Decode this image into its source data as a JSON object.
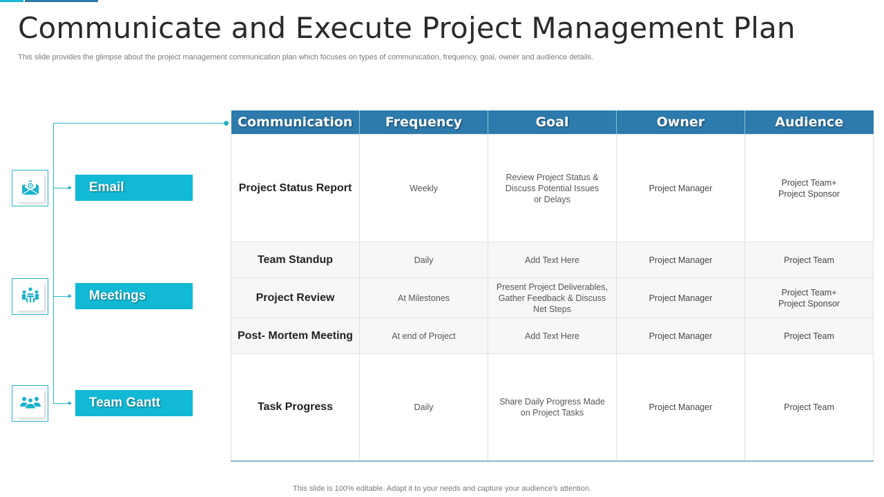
{
  "header": {
    "title": "Communicate and Execute Project Management Plan",
    "subtitle": "This slide provides the glimpse about the project management communication plan which focuses on types of communication, frequency, goal, owner and audience details."
  },
  "channels": [
    {
      "label": "Email",
      "icon": "email-envelope-icon"
    },
    {
      "label": "Meetings",
      "icon": "meeting-table-icon"
    },
    {
      "label": "Team Gantt",
      "icon": "team-group-icon"
    }
  ],
  "table": {
    "headers": [
      "Communication",
      "Frequency",
      "Goal",
      "Owner",
      "Audience"
    ],
    "rows": [
      {
        "communication": "Project Status Report",
        "frequency": "Weekly",
        "goal": [
          "Review  Project Status &",
          "Discuss Potential Issues",
          "or Delays"
        ],
        "owner": "Project Manager",
        "audience": [
          "Project Team+",
          "Project Sponsor"
        ]
      },
      {
        "communication": "Team Standup",
        "frequency": "Daily",
        "goal": [
          "Add Text Here"
        ],
        "owner": "Project Manager",
        "audience": [
          "Project Team"
        ]
      },
      {
        "communication": "Project Review",
        "frequency": "At Milestones",
        "goal": [
          "Present Project Deliverables,",
          "Gather Feedback & Discuss",
          "Net Steps"
        ],
        "owner": "Project Manager",
        "audience": [
          "Project Team+",
          "Project Sponsor"
        ]
      },
      {
        "communication": "Post- Mortem Meeting",
        "frequency": "At end of Project",
        "goal": [
          "Add Text Here"
        ],
        "owner": "Project Manager",
        "audience": [
          "Project Team"
        ]
      },
      {
        "communication": "Task Progress",
        "frequency": "Daily",
        "goal": [
          "Share Daily Progress Made",
          "on Project Tasks"
        ],
        "owner": "Project Manager",
        "audience": [
          "Project Team"
        ]
      }
    ]
  },
  "footer": "This slide is 100% editable. Adapt it to your needs and capture your audience's attention.",
  "colors": {
    "header_blue": "#2d7aac",
    "label_cyan": "#12b9d4",
    "connector_cyan": "#26b3cc",
    "accent_cyan": "#1ab8d3",
    "accent_blue": "#2d7aa6"
  }
}
